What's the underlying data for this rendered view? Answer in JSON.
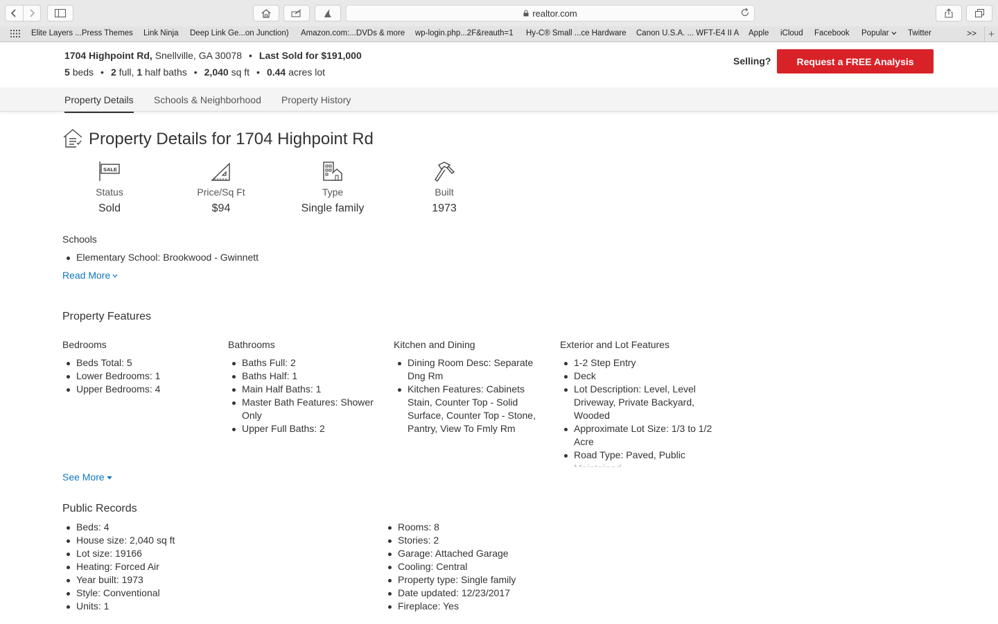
{
  "browser": {
    "url": "realtor.com",
    "bookmarks": [
      "Elite Layers ...Press Themes",
      "Link Ninja",
      "Deep Link Ge...on Junction)",
      "Amazon.com:...DVDs & more",
      "wp-login.php...2F&reauth=1",
      "Hy-C® Small ...ce Hardware",
      "Canon U.S.A. ... WFT-E4 II A",
      "Apple",
      "iCloud",
      "Facebook",
      "Popular",
      "Twitter"
    ],
    "more_label": ">>"
  },
  "header": {
    "address": "1704 Highpoint Rd,",
    "city": "Snellville, GA 30078",
    "last_sold": "Last Sold for $191,000",
    "beds_num": "5",
    "beds_label": "beds",
    "baths_full_num": "2",
    "baths_full_label": "full,",
    "baths_half_num": "1",
    "baths_half_label": "half baths",
    "sqft_num": "2,040",
    "sqft_label": "sq ft",
    "lot_num": "0.44",
    "lot_label": "acres lot",
    "selling_label": "Selling?",
    "cta_label": "Request a FREE Analysis",
    "cta_color": "#d92228"
  },
  "tabs": [
    "Property Details",
    "Schools & Neighborhood",
    "Property History"
  ],
  "details": {
    "title": "Property Details for 1704 Highpoint Rd",
    "stats": [
      {
        "label": "Status",
        "value": "Sold",
        "icon": "sale-sign-icon"
      },
      {
        "label": "Price/Sq Ft",
        "value": "$94",
        "icon": "ruler-triangle-icon"
      },
      {
        "label": "Type",
        "value": "Single family",
        "icon": "building-house-icon"
      },
      {
        "label": "Built",
        "value": "1973",
        "icon": "hammer-icon"
      }
    ],
    "sale_icon_text": "SALE"
  },
  "schools": {
    "heading": "Schools",
    "items": [
      "Elementary School: Brookwood - Gwinnett"
    ],
    "read_more": "Read More"
  },
  "features": {
    "heading": "Property Features",
    "columns": [
      {
        "title": "Bedrooms",
        "items": [
          "Beds Total: 5",
          "Lower Bedrooms: 1",
          "Upper Bedrooms: 4"
        ]
      },
      {
        "title": "Bathrooms",
        "items": [
          "Baths Full: 2",
          "Baths Half: 1",
          "Main Half Baths: 1",
          "Master Bath Features: Shower Only",
          "Upper Full Baths: 2"
        ]
      },
      {
        "title": "Kitchen and Dining",
        "items": [
          "Dining Room Desc: Separate Dng Rm",
          "Kitchen Features: Cabinets Stain, Counter Top - Solid Surface, Counter Top - Stone, Pantry, View To Fmly Rm"
        ]
      },
      {
        "title": "Exterior and Lot Features",
        "items": [
          "1-2 Step Entry",
          "Deck",
          "Lot Description: Level, Level Driveway, Private Backyard, Wooded",
          "Approximate Lot Size: 1/3 to 1/2 Acre",
          "Road Type: Paved, Public Maintained"
        ]
      }
    ],
    "see_more": "See More"
  },
  "public_records": {
    "heading": "Public Records",
    "left": [
      "Beds: 4",
      "House size: 2,040 sq ft",
      "Lot size: 19166",
      "Heating: Forced Air",
      "Year built: 1973",
      "Style: Conventional",
      "Units: 1"
    ],
    "right": [
      "Rooms: 8",
      "Stories: 2",
      "Garage: Attached Garage",
      "Cooling: Central",
      "Property type: Single family",
      "Date updated: 12/23/2017",
      "Fireplace: Yes"
    ]
  }
}
